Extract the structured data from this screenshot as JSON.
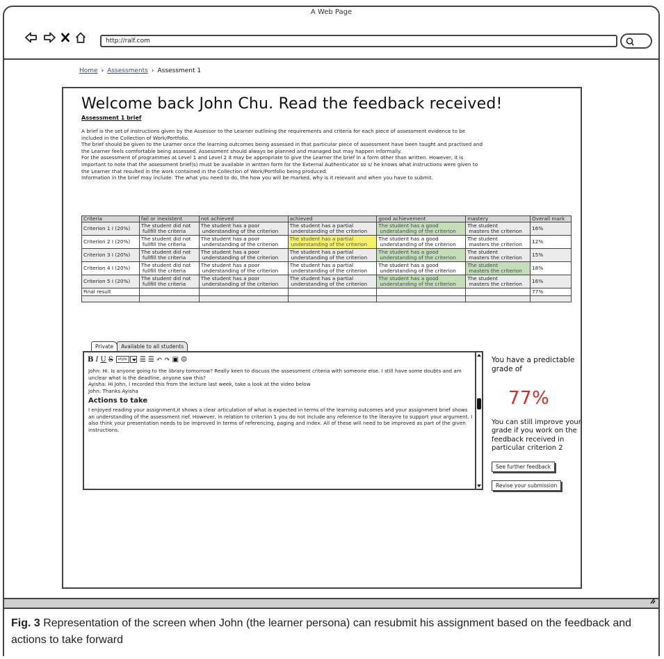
{
  "window": {
    "title": "A Web Page",
    "url": "http://ralf.com"
  },
  "icons": {
    "back": "back-arrow-icon",
    "forward": "forward-arrow-icon",
    "stop": "close-icon",
    "home": "home-icon",
    "search": "search-icon",
    "resize": "resize-grip-icon"
  },
  "breadcrumb": {
    "home": "Home",
    "assessments": "Assessments",
    "current": "Assessment 1",
    "separator": "›"
  },
  "page": {
    "title": "Welcome back John Chu. Read the feedback received!",
    "brief_heading": "Assessment 1 brief",
    "brief_paragraphs": [
      "A brief is the set of instructions given by the Assessor to the Learner outlining the requirements and criteria for each piece of assessment evidence to be included in the Collection of Work/Portfolio.",
      "The brief should be given to the Learner once the learning outcomes being assessed in that particular piece of assessment have been taught and practised and the Learner feels comfortable being assessed. Assessment should always be planned and managed but may happen informally.",
      "For the assessment of programmes at Level 1 and Level 2 it may be appropriate to give the Learner the brief in a form other than written. However, it is important to note that the assessment brief(s) must be available in written form for the External Authenticator so s/ he knows what instructions were given to the Learner that resulted in the work contained in the Collection of Work/Portfolio being produced.",
      "Information in the brief may include: The what you need to do, the how you will be marked, why is it relevant and when you have to submit."
    ]
  },
  "table": {
    "headers": [
      "Criteria",
      "fail or inexistent",
      "not achieved",
      "achieved",
      "good achievement",
      "mastery",
      "Overall mark"
    ],
    "cell_text": {
      "fail": [
        "The student did not",
        "fullfill the criteria"
      ],
      "not_achieved": [
        "The student has a poor",
        "understanding of the criterion"
      ],
      "achieved": [
        "The student has a partial",
        "understanding of the criterion"
      ],
      "good": [
        "The student has a good",
        "understanding of the criterion"
      ],
      "mastery": [
        "The student",
        "masters the criterion"
      ]
    },
    "rows": [
      {
        "criteria": "Criterion 1 I (20%)",
        "mark": "16%",
        "highlight": "good",
        "color": "green"
      },
      {
        "criteria": "Criterion 2 I (20%)",
        "mark": "12%",
        "highlight": "achieved",
        "color": "yellow"
      },
      {
        "criteria": "Criterion 3 I (20%)",
        "mark": "15%",
        "highlight": "good",
        "color": "green"
      },
      {
        "criteria": "Criterion 4 I (20%)",
        "mark": "18%",
        "highlight": "mastery",
        "color": "green"
      },
      {
        "criteria": "Criterion 5 I (20%)",
        "mark": "16%",
        "highlight": "good",
        "color": "green"
      }
    ],
    "final_label": "Final result",
    "final_mark": "77%",
    "highlight_colors": {
      "green": "#c6ddb9",
      "yellow": "#f5f26a"
    }
  },
  "tabs": [
    {
      "label": "Private",
      "active": true
    },
    {
      "label": "Available to all students",
      "active": false
    }
  ],
  "toolbar": {
    "bold": "B",
    "italic": "I",
    "underline": "U",
    "strike": "S",
    "style": "style",
    "bullet_list": "☰",
    "numbered_list": "☰",
    "undo": "↶",
    "redo": "↷",
    "image": "▣",
    "emoji": "☺"
  },
  "editor": {
    "chat_lines": [
      "John: Hi. Is anyone going to the library tomorrow? Really keen to discuss the assessment criteria with someone else. I still have some doubts and am unclear what is the deadline, anyone saw this?",
      "Ayisha: Hi John, I recorded this from the lecture last week, take a look at the video below",
      "John: Thanks Ayisha"
    ],
    "actions_title": "Actions to take",
    "actions_text": "I enjoyed reading your assignment,it shows a clear articulation of what is expected in terms of the learning outcomes and your assignment brief shows an understanding of the assessment rief. However, in relation to criterion 1 you do  not include any reference to the literayire to support your argument. I also think your presentation needs to be improved in terms of referencing, paging and index. All of these will need to be improved as part of the given instructions."
  },
  "grade": {
    "lead": "You have a predictable grade of",
    "value": "77%",
    "value_color": "#d62b2b",
    "note": "You can still improve your grade if you work on the feedback received in particular criterion 2",
    "feedback_button": "See further feedback",
    "revise_button": "Revise your submission"
  },
  "caption": {
    "label": "Fig. 3",
    "text": " Representation of the screen when John (the learner persona) can resubmit his assignment based on the feedback and actions to take forward"
  }
}
